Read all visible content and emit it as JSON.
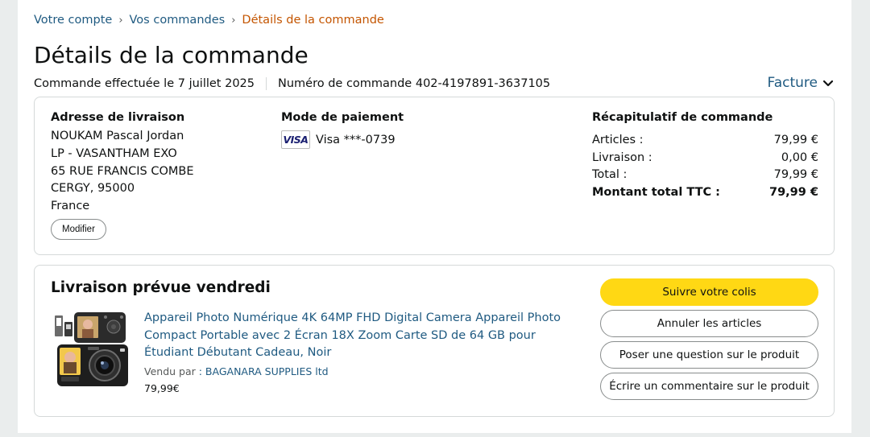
{
  "breadcrumb": {
    "items": [
      "Votre compte",
      "Vos commandes"
    ],
    "current": "Détails de la commande",
    "separator": "›"
  },
  "page_title": "Détails de la commande",
  "order_meta": {
    "placed": "Commande effectuée le 7 juillet 2025",
    "number": "Numéro de commande 402-4197891-3637105"
  },
  "invoice_label": "Facture",
  "shipping": {
    "title": "Adresse de livraison",
    "lines": [
      "NOUKAM Pascal Jordan",
      "LP - VASANTHAM EXO",
      "65 RUE FRANCIS COMBE",
      "CERGY, 95000",
      "France"
    ],
    "edit_label": "Modifier"
  },
  "payment": {
    "title": "Mode de paiement",
    "card_brand": "VISA",
    "card_text": "Visa ***-0739"
  },
  "summary": {
    "title": "Récapitulatif de commande",
    "rows": [
      {
        "label": "Articles :",
        "value": "79,99 €"
      },
      {
        "label": "Livraison :",
        "value": "0,00 €"
      },
      {
        "label": "Total :",
        "value": "79,99 €"
      },
      {
        "label": "Montant total TTC :",
        "value": "79,99 €"
      }
    ]
  },
  "delivery": {
    "title": "Livraison prévue vendredi",
    "product_title": "Appareil Photo Numérique 4K 64MP FHD Digital Camera Appareil Photo Compact Portable avec 2 Écran 18X Zoom Carte SD de 64 GB pour Étudiant Débutant Cadeau, Noir",
    "sold_by_label": "Vendu par",
    "seller": ": BAGANARA SUPPLIES ltd",
    "price": "79,99€"
  },
  "actions": {
    "track": "Suivre votre colis",
    "cancel": "Annuler les articles",
    "question": "Poser une question sur le produit",
    "review": "Écrire un commentaire sur le produit"
  },
  "colors": {
    "link": "#1f5a81",
    "breadcrumb_current": "#c45500",
    "primary_button": "#ffd814",
    "background": "#eaeded"
  }
}
